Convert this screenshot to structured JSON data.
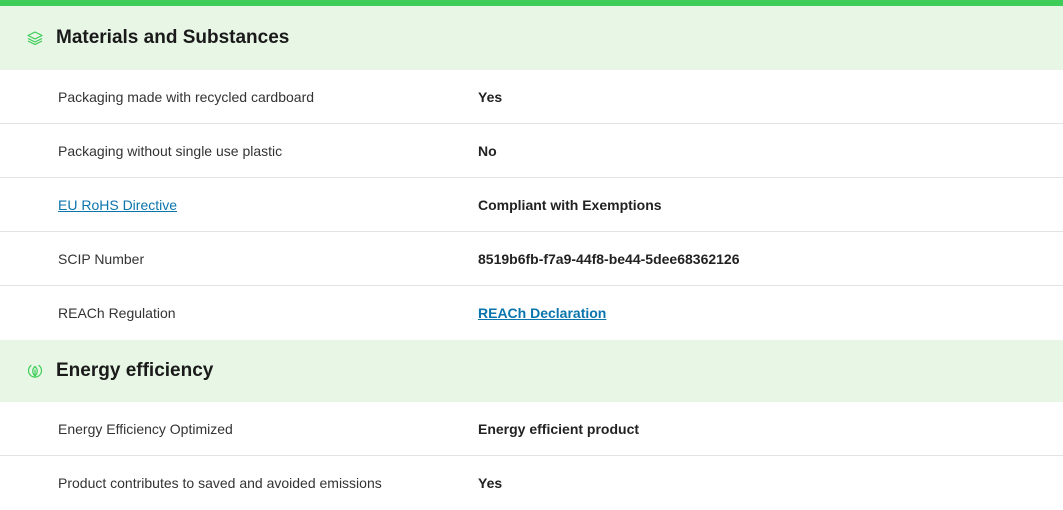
{
  "colors": {
    "accent": "#3dcd58",
    "header_bg": "#e7f6e5",
    "link": "#0a75ad"
  },
  "sections": [
    {
      "title": "Materials and Substances",
      "icon": "layers-icon",
      "rows": [
        {
          "label": "Packaging made with recycled cardboard",
          "value": "Yes"
        },
        {
          "label": "Packaging without single use plastic",
          "value": "No"
        },
        {
          "label": "EU RoHS Directive",
          "value": "Compliant with Exemptions"
        },
        {
          "label": "SCIP Number",
          "value": "8519b6fb-f7a9-44f8-be44-5dee68362126"
        },
        {
          "label": "REACh Regulation",
          "value": "REACh Declaration"
        }
      ]
    },
    {
      "title": "Energy efficiency",
      "icon": "leaf-icon",
      "rows": [
        {
          "label": "Energy Efficiency Optimized",
          "value": "Energy efficient product"
        },
        {
          "label": "Product contributes to saved and avoided emissions",
          "value": "Yes"
        }
      ]
    }
  ]
}
